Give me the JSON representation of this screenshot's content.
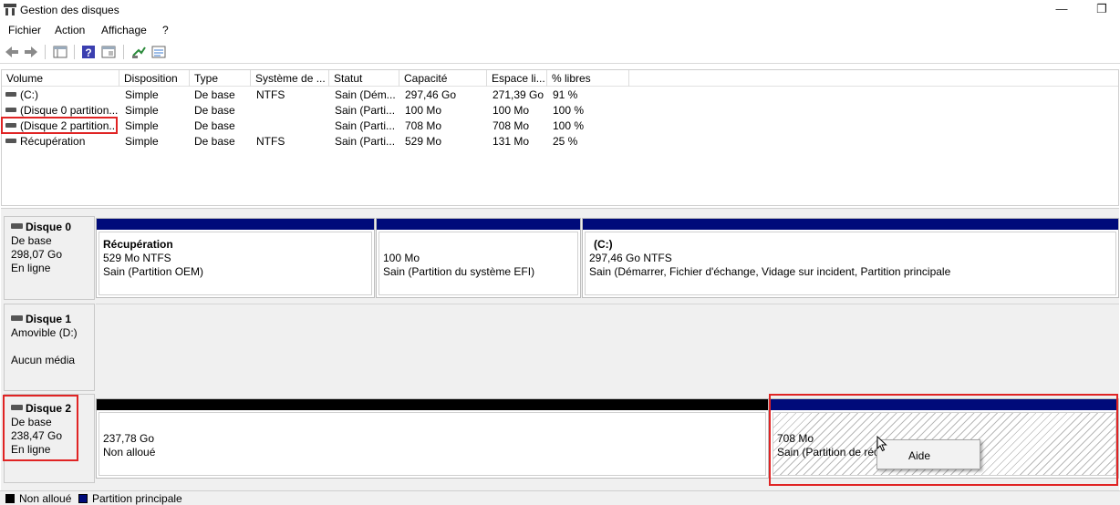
{
  "window": {
    "title": "Gestion des disques",
    "minimize_glyph": "—",
    "restore_glyph": "❐"
  },
  "menu": [
    "Fichier",
    "Action",
    "Affichage",
    "?"
  ],
  "toolbar_icons": [
    "back-arrow-icon",
    "forward-arrow-icon",
    "console-tree-icon",
    "help-icon",
    "properties-icon",
    "connect-icon",
    "settings-icon"
  ],
  "volume_list": {
    "columns": [
      "Volume",
      "Disposition",
      "Type",
      "Système de ...",
      "Statut",
      "Capacité",
      "Espace li...",
      "% libres"
    ],
    "rows": [
      [
        "(C:)",
        "Simple",
        "De base",
        "NTFS",
        "Sain (Dém...",
        "297,46 Go",
        "271,39 Go",
        "91 %"
      ],
      [
        "(Disque 0 partition...",
        "Simple",
        "De base",
        "",
        "Sain (Parti...",
        "100 Mo",
        "100 Mo",
        "100 %"
      ],
      [
        "(Disque 2 partition...",
        "Simple",
        "De base",
        "",
        "Sain (Parti...",
        "708 Mo",
        "708 Mo",
        "100 %"
      ],
      [
        "Récupération",
        "Simple",
        "De base",
        "NTFS",
        "Sain (Parti...",
        "529 Mo",
        "131 Mo",
        "25 %"
      ]
    ]
  },
  "disks": {
    "disk0": {
      "name": "Disque 0",
      "type": "De base",
      "size": "298,07 Go",
      "status": "En ligne",
      "partitions": [
        {
          "title": "Récupération",
          "line1": "529 Mo NTFS",
          "line2": "Sain (Partition OEM)"
        },
        {
          "title": "",
          "line1": "100 Mo",
          "line2": "Sain (Partition du système EFI)"
        },
        {
          "title": "(C:)",
          "line1": "297,46 Go NTFS",
          "line2": "Sain (Démarrer, Fichier d'échange, Vidage sur incident, Partition principale"
        }
      ]
    },
    "disk1": {
      "name": "Disque 1",
      "type": "Amovible (D:)",
      "status": "Aucun média"
    },
    "disk2": {
      "name": "Disque 2",
      "type": "De base",
      "size": "238,47 Go",
      "status": "En ligne",
      "partitions": [
        {
          "line1": "237,78 Go",
          "line2": "Non alloué"
        },
        {
          "line1": "708 Mo",
          "line2": "Sain (Partition de réc"
        }
      ]
    }
  },
  "context_menu": {
    "item": "Aide"
  },
  "legend": {
    "unallocated": "Non alloué",
    "primary": "Partition principale"
  },
  "colors": {
    "primary_partition": "#000b7a",
    "unallocated": "#000000",
    "highlight": "#e02424"
  }
}
